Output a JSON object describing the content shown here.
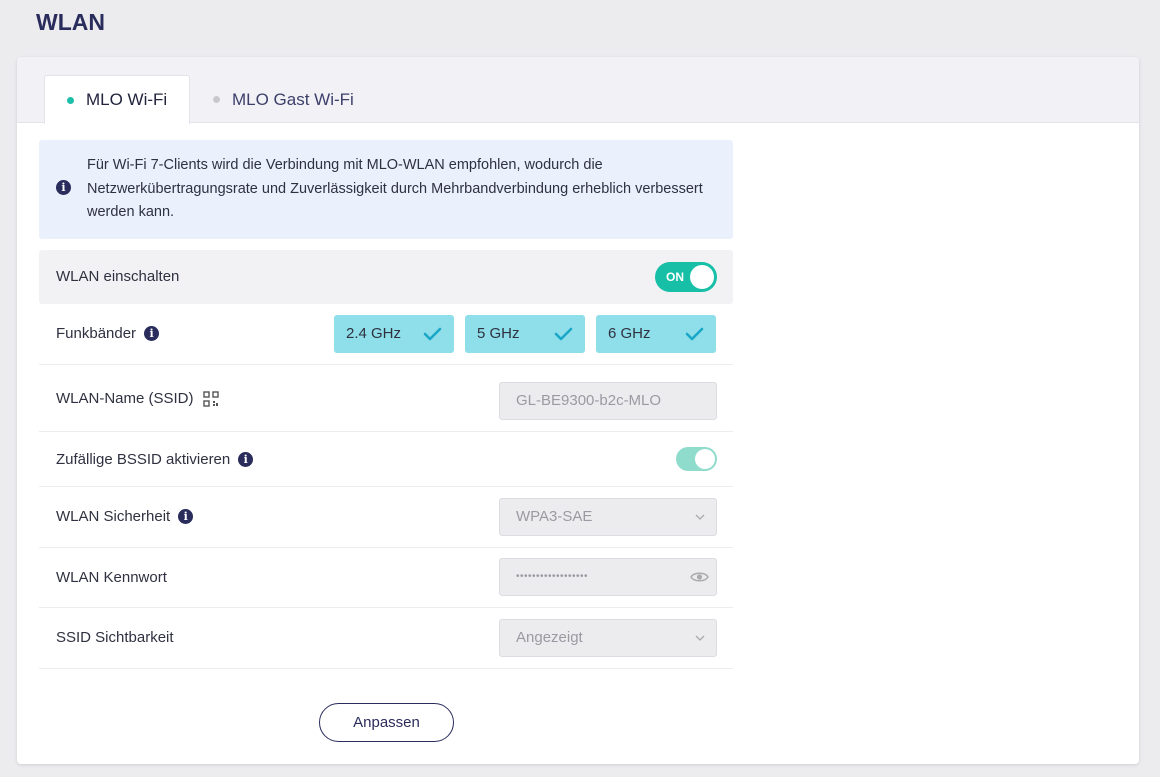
{
  "page": {
    "title": "WLAN"
  },
  "tabs": [
    {
      "label": "MLO Wi-Fi",
      "active": true
    },
    {
      "label": "MLO Gast Wi-Fi",
      "active": false
    }
  ],
  "info": {
    "icon": "info-icon",
    "text": "Für Wi-Fi 7-Clients wird die Verbindung mit MLO-WLAN empfohlen, wodurch die Netzwerkübertragungsrate und Zuverlässigkeit durch Mehrbandverbindung erheblich verbessert werden kann."
  },
  "wlan_enable": {
    "label": "WLAN einschalten",
    "toggle_text": "ON",
    "enabled": true
  },
  "bands": {
    "label": "Funkbänder",
    "options": [
      {
        "label": "2.4 GHz",
        "checked": true
      },
      {
        "label": "5 GHz",
        "checked": true
      },
      {
        "label": "6 GHz",
        "checked": true
      }
    ]
  },
  "ssid": {
    "label": "WLAN-Name (SSID)",
    "value": "GL-BE9300-b2c-MLO",
    "icon": "qr-code-icon"
  },
  "random_bssid": {
    "label": "Zufällige BSSID aktivieren",
    "enabled": true
  },
  "security": {
    "label": "WLAN Sicherheit",
    "value": "WPA3-SAE"
  },
  "password": {
    "label": "WLAN Kennwort",
    "value": "••••••••••••••••••",
    "icon": "eye-icon"
  },
  "visibility": {
    "label": "SSID Sichtbarkeit",
    "value": "Angezeigt"
  },
  "actions": {
    "apply_label": "Anpassen"
  },
  "colors": {
    "accent": "#17bfa6",
    "band_bg": "#8edfe9",
    "title": "#2a2d5c",
    "info_bg": "#eaf0fc"
  }
}
